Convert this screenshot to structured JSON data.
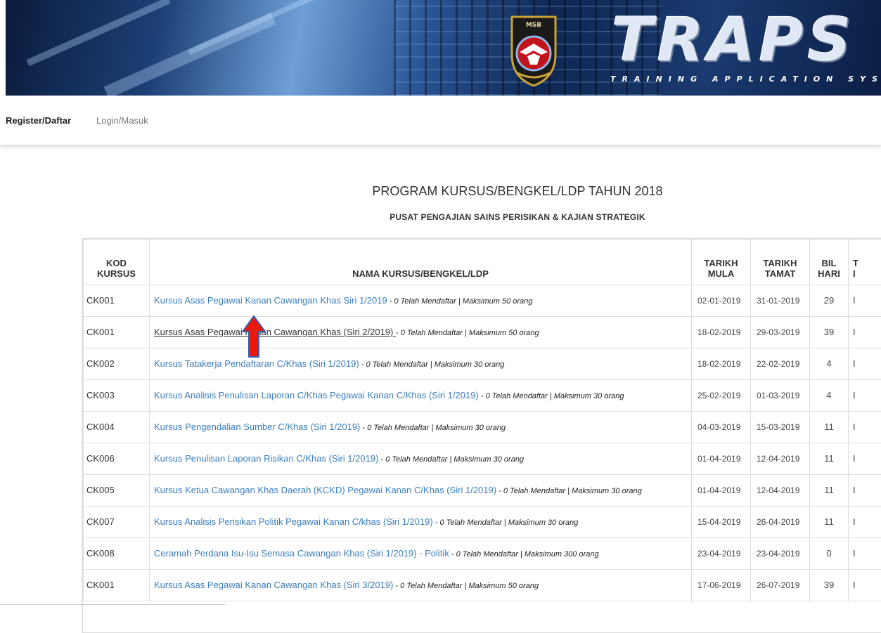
{
  "banner": {
    "emblem_text": "MSB",
    "logo_text": "TRAPS",
    "tagline": "TRAINING APPLICATION SYS"
  },
  "nav": {
    "register_label": "Register/Daftar",
    "login_label": "Login/Masuk"
  },
  "page": {
    "title": "PROGRAM KURSUS/BENGKEL/LDP TAHUN 2018",
    "subtitle": "PUSAT PENGAJIAN SAINS PERISIKAN & KAJIAN STRATEGIK"
  },
  "table": {
    "headers": {
      "kod_line1": "KOD",
      "kod_line2": "KURSUS",
      "nama": "NAMA KURSUS/BENGKEL/LDP",
      "mula_line1": "TARIKH",
      "mula_line2": "MULA",
      "tamat_line1": "TARIKH",
      "tamat_line2": "TAMAT",
      "hari_line1": "BIL",
      "hari_line2": "HARI",
      "last_line1": "T",
      "last_line2": "I"
    },
    "rows": [
      {
        "kod": "CK001",
        "nama": "Kursus Asas Pegawai Kanan Cawangan Khas Siri 1/2019",
        "meta": " - 0 Telah Mendaftar | Maksimum 50 orang",
        "mula": "02-01-2019",
        "tamat": "31-01-2019",
        "hari": "29",
        "last": "I"
      },
      {
        "kod": "CK001",
        "nama": "Kursus Asas Pegawai Kanan Cawangan Khas (Siri 2/2019) ",
        "meta": " - 0 Telah Mendaftar | Maksimum 50 orang",
        "mula": "18-02-2019",
        "tamat": "29-03-2019",
        "hari": "39",
        "last": "I"
      },
      {
        "kod": "CK002",
        "nama": "Kursus Tatakerja Pendaftaran C/Khas (Siri 1/2019)",
        "meta": " - 0 Telah Mendaftar | Maksimum 30 orang",
        "mula": "18-02-2019",
        "tamat": "22-02-2019",
        "hari": "4",
        "last": "I"
      },
      {
        "kod": "CK003",
        "nama": "Kursus Analisis Penulisan Laporan C/Khas Pegawai Kanan C/Khas (Siri 1/2019)",
        "meta": " - 0 Telah Mendaftar | Maksimum 30 orang",
        "mula": "25-02-2019",
        "tamat": "01-03-2019",
        "hari": "4",
        "last": "I"
      },
      {
        "kod": "CK004",
        "nama": "Kursus Pengendalian Sumber C/Khas (Siri 1/2019)",
        "meta": " - 0 Telah Mendaftar | Maksimum 30 orang",
        "mula": "04-03-2019",
        "tamat": "15-03-2019",
        "hari": "11",
        "last": "I"
      },
      {
        "kod": "CK006",
        "nama": "Kursus Penulisan Laporan Risikan C/Khas (Siri 1/2019)",
        "meta": " - 0 Telah Mendaftar | Maksimum 30 orang",
        "mula": "01-04-2019",
        "tamat": "12-04-2019",
        "hari": "11",
        "last": "I"
      },
      {
        "kod": "CK005",
        "nama": "Kursus Ketua Cawangan Khas Daerah (KCKD) Pegawai Kanan C/Khas (Siri 1/2019)",
        "meta": " - 0 Telah Mendaftar | Maksimum 30 orang",
        "mula": "01-04-2019",
        "tamat": "12-04-2019",
        "hari": "11",
        "last": "I"
      },
      {
        "kod": "CK007",
        "nama": "Kursus Analisis Perisikan Politik Pegawai Kanan C/khas (Siri 1/2019)",
        "meta": " - 0 Telah Mendaftar | Maksimum 30 orang",
        "mula": "15-04-2019",
        "tamat": "26-04-2019",
        "hari": "11",
        "last": "I"
      },
      {
        "kod": "CK008",
        "nama": "Ceramah Perdana Isu-Isu Semasa Cawangan Khas (Siri 1/2019) - Politik",
        "meta": " - 0 Telah Mendaftar | Maksimum 300 orang",
        "mula": "23-04-2019",
        "tamat": "23-04-2019",
        "hari": "0",
        "last": "I"
      },
      {
        "kod": "CK001",
        "nama": "Kursus Asas Pegawai Kanan Cawangan Khas (Siri 3/2019)",
        "meta": " - 0 Telah Mendaftar | Maksimum 50 orang",
        "mula": "17-06-2019",
        "tamat": "26-07-2019",
        "hari": "39",
        "last": "I"
      }
    ]
  },
  "colors": {
    "link": "#3a7dbd",
    "arrow_fill": "#e8180c",
    "arrow_outline": "#3a5fb0"
  }
}
